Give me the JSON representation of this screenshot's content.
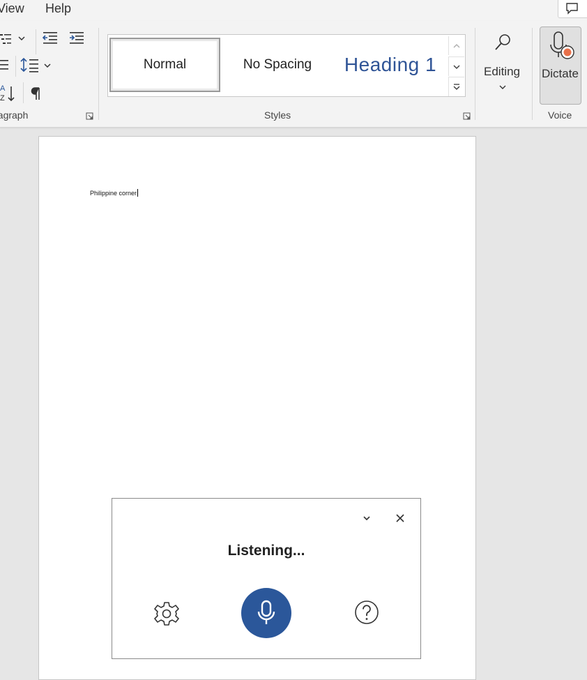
{
  "menubar": {
    "view_label": "View",
    "help_label": "Help"
  },
  "ribbon": {
    "paragraph_group_label": "Paragraph",
    "styles_group_label": "Styles",
    "styles": [
      {
        "label": "Normal",
        "selected": true
      },
      {
        "label": "No Spacing",
        "selected": false
      },
      {
        "label": "Heading 1",
        "selected": false,
        "color": "#2f5496"
      }
    ],
    "editing_label": "Editing",
    "dictate_label": "Dictate",
    "voice_group_label": "Voice",
    "accent_color": "#2b579a",
    "record_dot_color": "#e8704a"
  },
  "document": {
    "body_text": "Philippine corner"
  },
  "dictation_panel": {
    "status_text": "Listening...",
    "mic_color": "#2b579a"
  }
}
